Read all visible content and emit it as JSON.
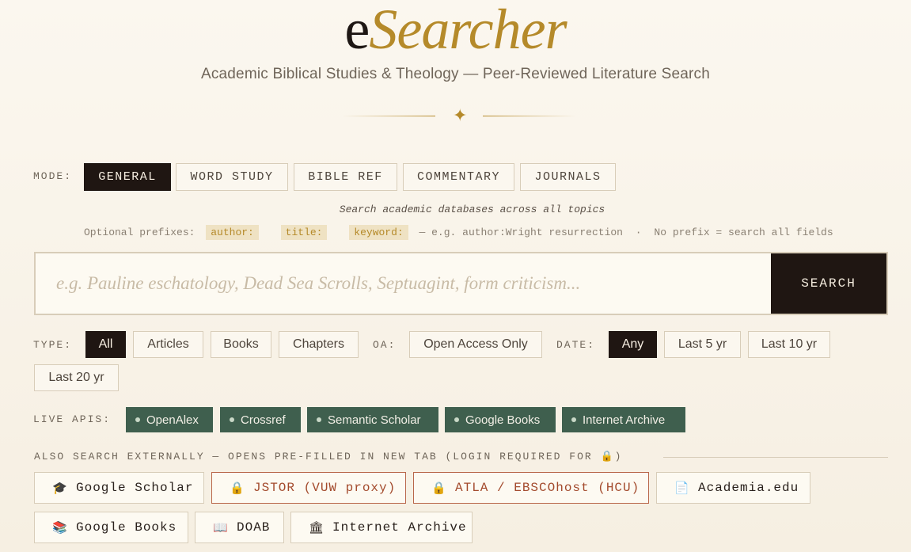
{
  "header": {
    "title_prefix": "e",
    "title_main": "Searcher",
    "subtitle": "Academic Biblical Studies & Theology — Peer-Reviewed Literature Search",
    "ornament": "✦"
  },
  "mode": {
    "label": "MODE:",
    "options": [
      "GENERAL",
      "WORD STUDY",
      "BIBLE REF",
      "COMMENTARY",
      "JOURNALS"
    ],
    "selected": "GENERAL",
    "hint": "Search academic databases across all topics"
  },
  "prefixes": {
    "intro": "Optional prefixes:",
    "chips": [
      "author:",
      "title:",
      "keyword:"
    ],
    "example": "— e.g. author:Wright resurrection",
    "separator": "·",
    "note": "No prefix = search all fields"
  },
  "search": {
    "placeholder": "e.g. Pauline eschatology, Dead Sea Scrolls, Septuagint, form criticism...",
    "value": "",
    "button_label": "SEARCH"
  },
  "filters": {
    "type_label": "TYPE:",
    "type_options": [
      "All",
      "Articles",
      "Books",
      "Chapters"
    ],
    "type_selected": "All",
    "oa_label": "OA:",
    "oa_option": "Open Access Only",
    "date_label": "DATE:",
    "date_options": [
      "Any",
      "Last 5 yr",
      "Last 10 yr",
      "Last 20 yr"
    ],
    "date_selected": "Any"
  },
  "apis": {
    "label": "LIVE APIS:",
    "items": [
      "OpenAlex",
      "Crossref",
      "Semantic Scholar",
      "Google Books",
      "Internet Archive"
    ]
  },
  "external": {
    "label": "ALSO SEARCH EXTERNALLY — OPENS PRE-FILLED IN NEW TAB (LOGIN REQUIRED FOR 🔒)",
    "links": [
      {
        "label": "Google Scholar",
        "icon": "graduation-cap-icon",
        "glyph": "🎓",
        "locked": false
      },
      {
        "label": "JSTOR (VUW proxy)",
        "icon": "lock-icon",
        "glyph": "🔒",
        "locked": true
      },
      {
        "label": "ATLA / EBSCOhost (HCU)",
        "icon": "lock-icon",
        "glyph": "🔒",
        "locked": true
      },
      {
        "label": "Academia.edu",
        "icon": "document-icon",
        "glyph": "📄",
        "locked": false
      },
      {
        "label": "Google Books",
        "icon": "books-icon",
        "glyph": "📚",
        "locked": false
      },
      {
        "label": "DOAB",
        "icon": "open-book-icon",
        "glyph": "📖",
        "locked": false
      },
      {
        "label": "Internet Archive",
        "icon": "archive-building-icon",
        "glyph": "🏛",
        "locked": false
      }
    ]
  },
  "colors": {
    "accent_gold": "#b58a2a",
    "dark": "#1f1612",
    "api_green": "#3f5f4e",
    "locked_red": "#a34a2c"
  }
}
